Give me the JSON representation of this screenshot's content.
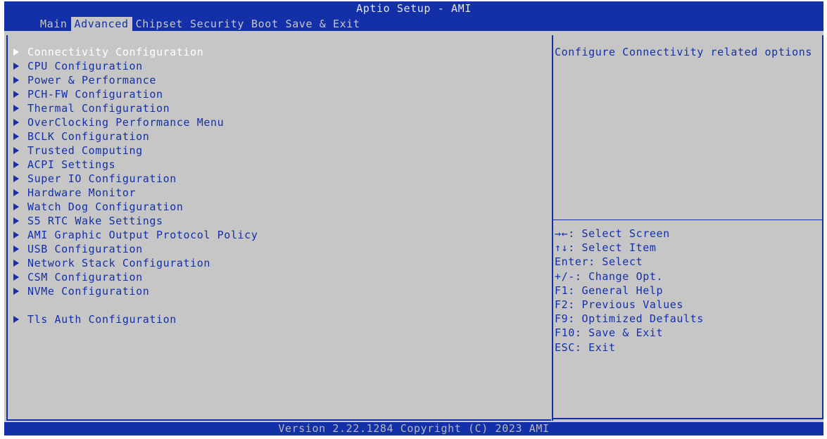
{
  "header": {
    "title": "Aptio Setup - AMI",
    "tabs": [
      {
        "label": "Main",
        "active": false
      },
      {
        "label": "Advanced",
        "active": true
      },
      {
        "label": "Chipset",
        "active": false
      },
      {
        "label": "Security",
        "active": false
      },
      {
        "label": "Boot",
        "active": false
      },
      {
        "label": "Save & Exit",
        "active": false
      }
    ]
  },
  "menu": {
    "selected_index": 0,
    "items": [
      {
        "label": "Connectivity Configuration"
      },
      {
        "label": "CPU Configuration"
      },
      {
        "label": "Power & Performance"
      },
      {
        "label": "PCH-FW Configuration"
      },
      {
        "label": "Thermal Configuration"
      },
      {
        "label": "OverClocking Performance Menu"
      },
      {
        "label": "BCLK Configuration"
      },
      {
        "label": "Trusted Computing"
      },
      {
        "label": "ACPI Settings"
      },
      {
        "label": "Super IO Configuration"
      },
      {
        "label": "Hardware Monitor"
      },
      {
        "label": "Watch Dog Configuration"
      },
      {
        "label": "S5 RTC Wake Settings"
      },
      {
        "label": "AMI Graphic Output Protocol Policy"
      },
      {
        "label": "USB Configuration"
      },
      {
        "label": "Network Stack Configuration"
      },
      {
        "label": "CSM Configuration"
      },
      {
        "label": "NVMe Configuration"
      },
      {
        "label": "Tls Auth Configuration"
      }
    ]
  },
  "help": {
    "description": "Configure Connectivity related options",
    "keys": [
      "→←: Select Screen",
      "↑↓: Select Item",
      "Enter: Select",
      "+/-: Change Opt.",
      "F1: General Help",
      "F2: Previous Values",
      "F9: Optimized Defaults",
      "F10: Save & Exit",
      "ESC: Exit"
    ]
  },
  "footer": {
    "version": "Version 2.22.1284 Copyright (C) 2023 AMI"
  },
  "colors": {
    "bar_blue": "#1330a8",
    "panel_gray": "#c6c6c6",
    "text_blue": "#1330a8",
    "selected_text": "#ffffff"
  }
}
